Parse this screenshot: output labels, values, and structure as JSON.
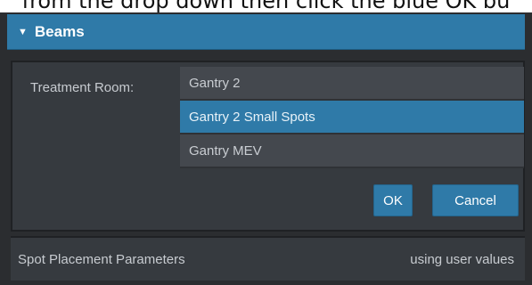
{
  "instruction_text": "from the drop down then click the blue OK bu",
  "section": {
    "title": "Beams"
  },
  "treatment_room": {
    "label": "Treatment Room:",
    "options": [
      "Gantry 2",
      "Gantry 2 Small Spots",
      "Gantry MEV"
    ],
    "selected": "Gantry 2 Small Spots"
  },
  "buttons": {
    "ok": "OK",
    "cancel": "Cancel"
  },
  "footer": {
    "label": "Spot Placement Parameters",
    "value": "using user values"
  },
  "colors": {
    "accent": "#2f7aa8",
    "background": "#2b2d30",
    "panel": "#363a3f"
  }
}
